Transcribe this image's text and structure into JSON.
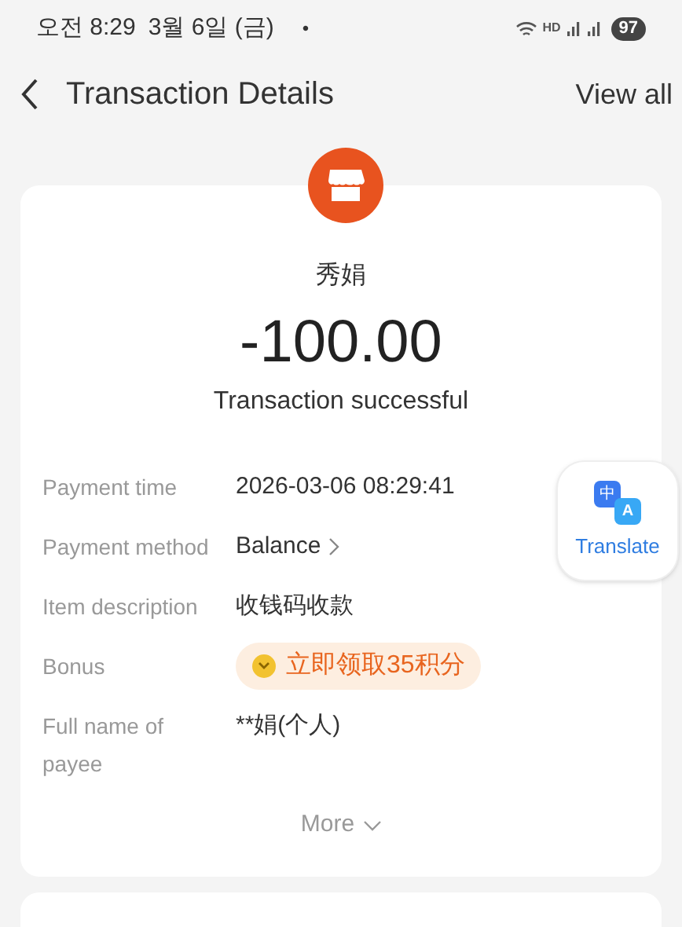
{
  "status_bar": {
    "time": "오전 8:29",
    "date": "3월 6일 (금)",
    "dot": "•",
    "network": "HD",
    "battery": "97"
  },
  "header": {
    "title": "Transaction Details",
    "action": "View all"
  },
  "transaction": {
    "payee": "秀娟",
    "amount": "-100.00",
    "status": "Transaction successful"
  },
  "details": [
    {
      "kind": "text",
      "label": "Payment time",
      "value": "2026-03-06 08:29:41"
    },
    {
      "kind": "link",
      "label": "Payment method",
      "value": "Balance"
    },
    {
      "kind": "text",
      "label": "Item description",
      "value": "收钱码收款"
    },
    {
      "kind": "bonus",
      "label": "Bonus",
      "value": "立即领取35积分"
    },
    {
      "kind": "text",
      "label": "Full name of payee",
      "value": "**娟(个人)"
    }
  ],
  "more": {
    "label": "More"
  },
  "translate": {
    "label": "Translate",
    "glyph_top": "中",
    "glyph_bottom": "A"
  }
}
